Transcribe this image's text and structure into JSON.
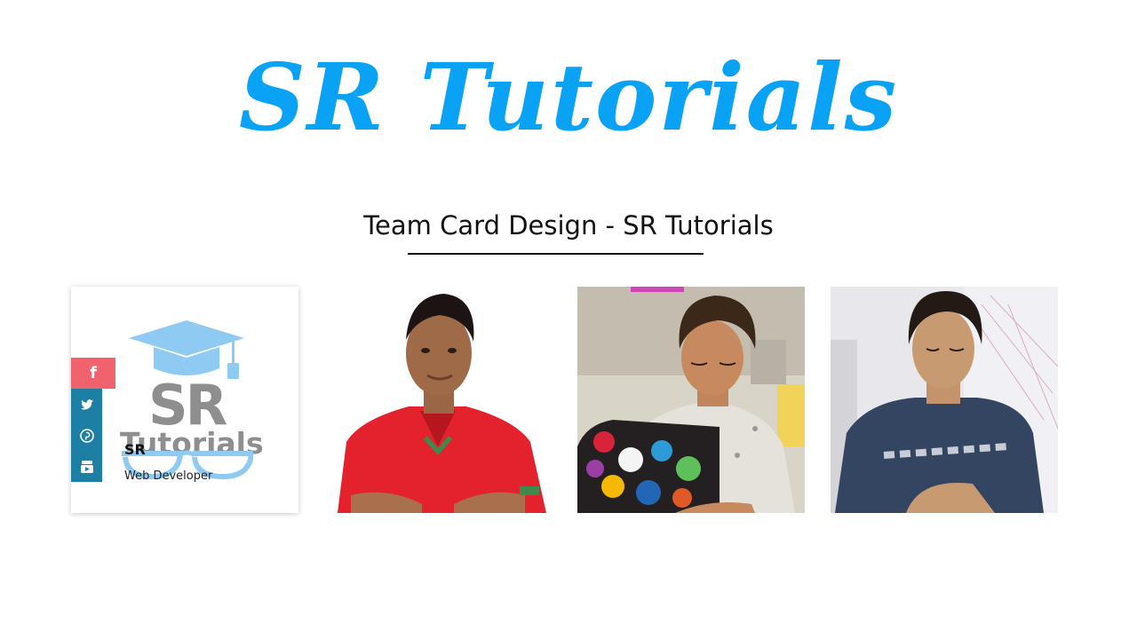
{
  "header": {
    "brand": "SR Tutorials",
    "brand_color": "#0aa2f5"
  },
  "section": {
    "title": "Team Card Design - SR Tutorials"
  },
  "cards": [
    {
      "logo_letters": "SR",
      "logo_word": "Tutorials",
      "name": "SR",
      "role": "Web Developer",
      "social": [
        "facebook-icon",
        "twitter-icon",
        "pinterest-icon",
        "youtube-icon"
      ],
      "facebook_glyph": "f",
      "social_colors": {
        "active": "#f0636e",
        "default": "#1e7fa5"
      }
    },
    {
      "photo": "man-in-red-shirt-photo"
    },
    {
      "photo": "man-with-laptop-photo"
    },
    {
      "photo": "man-in-navy-tshirt-photo"
    }
  ]
}
